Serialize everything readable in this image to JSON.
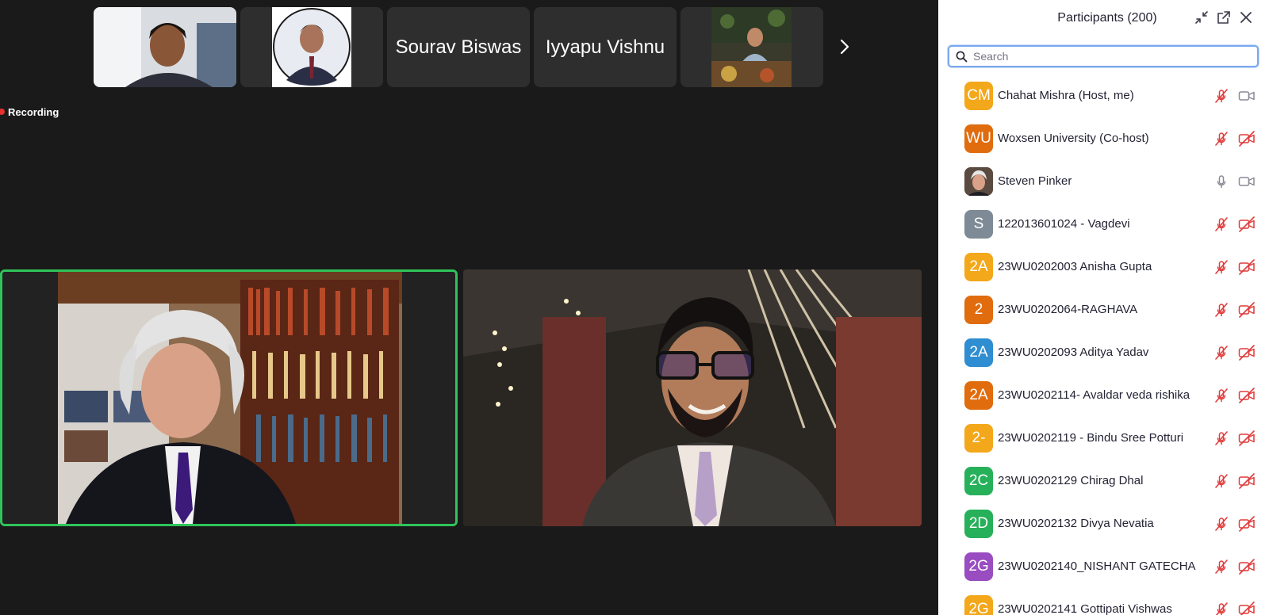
{
  "thumbnails": [
    {
      "type": "photo",
      "subject": "woman-portrait"
    },
    {
      "type": "photo",
      "subject": "man-circle-portrait"
    },
    {
      "type": "name",
      "label": "Sourav Biswas"
    },
    {
      "type": "name",
      "label": "Iyyapu Vishnu"
    },
    {
      "type": "photo",
      "subject": "person-at-table"
    }
  ],
  "recording": {
    "label": "Recording",
    "color": "#e5322d"
  },
  "panel": {
    "title": "Participants (200)",
    "search_placeholder": "Search",
    "icons": {
      "collapse": "collapse-icon",
      "popout": "popout-icon",
      "close": "close-icon",
      "search": "search-icon"
    }
  },
  "participants": [
    {
      "initials": "CM",
      "name": "Chahat Mishra (Host, me)",
      "color": "#f3a71a",
      "mic": "muted",
      "cam": "on"
    },
    {
      "initials": "WU",
      "name": "Woxsen University (Co-host)",
      "color": "#e06c0e",
      "mic": "muted",
      "cam": "off"
    },
    {
      "initials": "",
      "name": "Steven Pinker",
      "color": "#8a7a6c",
      "mic": "on",
      "cam": "on",
      "photo": true
    },
    {
      "initials": "S",
      "name": "122013601024 - Vagdevi",
      "color": "#7e8b96",
      "mic": "muted",
      "cam": "off"
    },
    {
      "initials": "2A",
      "name": "23WU0202003 Anisha Gupta",
      "color": "#f3a71a",
      "mic": "muted",
      "cam": "off"
    },
    {
      "initials": "2",
      "name": "23WU0202064-RAGHAVA",
      "color": "#e06c0e",
      "mic": "muted",
      "cam": "off"
    },
    {
      "initials": "2A",
      "name": "23WU0202093 Aditya Yadav",
      "color": "#2f8dd1",
      "mic": "muted",
      "cam": "off"
    },
    {
      "initials": "2A",
      "name": "23WU0202114- Avaldar veda rishika",
      "color": "#e06c0e",
      "mic": "muted",
      "cam": "off"
    },
    {
      "initials": "2-",
      "name": "23WU0202119 - Bindu Sree Potturi",
      "color": "#f3a71a",
      "mic": "muted",
      "cam": "off"
    },
    {
      "initials": "2C",
      "name": "23WU0202129 Chirag Dhal",
      "color": "#27b05a",
      "mic": "muted",
      "cam": "off"
    },
    {
      "initials": "2D",
      "name": "23WU0202132 Divya Nevatia",
      "color": "#27b05a",
      "mic": "muted",
      "cam": "off"
    },
    {
      "initials": "2G",
      "name": "23WU0202140_NISHANT GATECHA",
      "color": "#9a4cc1",
      "mic": "muted",
      "cam": "off"
    },
    {
      "initials": "2G",
      "name": "23WU0202141 Gottipati Vishwas",
      "color": "#f3a71a",
      "mic": "muted",
      "cam": "off"
    }
  ],
  "colors": {
    "active_speaker_border": "#2fc45a",
    "panel_bg": "#ffffff",
    "stage_bg": "#1a1a1a",
    "muted_icon": "#e03c3c"
  }
}
